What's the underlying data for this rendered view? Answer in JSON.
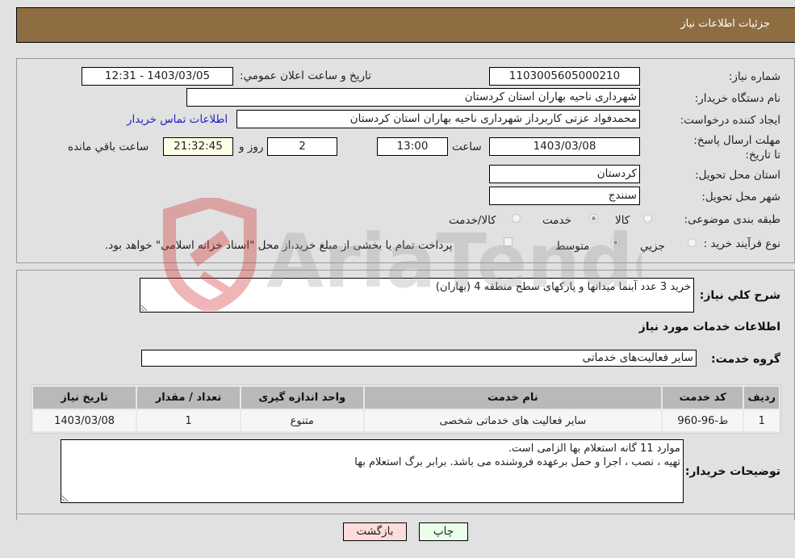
{
  "header": {
    "title": "جزئیات اطلاعات نیاز"
  },
  "form": {
    "need_number": {
      "label": "شماره نیاز:",
      "value": "1103005605000210"
    },
    "announce_datetime": {
      "label": "تاریخ و ساعت اعلان عمومي:",
      "value": "1403/03/05 - 12:31"
    },
    "buyer_org": {
      "label": "نام دستگاه خریدار:",
      "value": "شهرداری ناحیه بهاران استان کردستان"
    },
    "requester": {
      "label": "ایجاد کننده درخواست:",
      "value": "محمدفواد عزتی کاربرداز شهرداری ناحیه بهاران استان کردستان"
    },
    "buyer_contact_link": "اطلاعات تماس خریدار",
    "deadline": {
      "label": "مهلت ارسال پاسخ: تا تاریخ:",
      "date": "1403/03/08",
      "time_label": "ساعت",
      "time": "13:00",
      "days": "2",
      "days_label": "روز و",
      "remaining": "21:32:45",
      "remaining_label": "ساعت باقي مانده"
    },
    "delivery_province": {
      "label": "استان محل تحویل:",
      "value": "کردستان"
    },
    "delivery_city": {
      "label": "شهر محل تحویل:",
      "value": "سنندج"
    },
    "category": {
      "label": "طبقه بندی موضوعی:",
      "options": [
        {
          "label": "کالا",
          "selected": false
        },
        {
          "label": "خدمت",
          "selected": true
        },
        {
          "label": "کالا/خدمت",
          "selected": false
        }
      ]
    },
    "purchase_process": {
      "label": "نوع فرآیند خرید :",
      "options": [
        {
          "label": "جزيي",
          "selected": false
        },
        {
          "label": "متوسط",
          "selected": true
        }
      ],
      "treasury_checkbox": {
        "label": "پرداخت تمام یا بخشی از مبلغ خرید،از محل \"اسناد خزانه اسلامی\" خواهد بود.",
        "checked": false
      }
    }
  },
  "details": {
    "summary_label": "شرح کلي نیاز:",
    "summary_value": "خرید 3 عدد آبنما میدانها و پارکهای سطح منطقه 4 (بهاران)",
    "services_heading": "اطلاعات خدمات مورد نیاز",
    "service_group_label": "گروه خدمت:",
    "service_group_value": "سایر فعالیت‌های خدماتی",
    "table": {
      "columns": [
        "ردیف",
        "کد خدمت",
        "نام خدمت",
        "واحد اندازه گیری",
        "تعداد / مقدار",
        "تاریخ نیاز"
      ],
      "rows": [
        [
          "1",
          "ط-96-960",
          "سایر فعالیت های خدماتی شخصی",
          "متنوع",
          "1",
          "1403/03/08"
        ]
      ]
    },
    "buyer_notes_label": "توضیحات خریدار:",
    "buyer_notes_value": "موارد 11 گانه استعلام بها الزامی است.\nتهیه ، نصب ، اجرا و حمل برعهده فروشنده می باشد. برابر برگ استعلام بها"
  },
  "buttons": {
    "print": "چاپ",
    "back": "بازگشت"
  },
  "colors": {
    "header_bg": "#8e6d42",
    "print_bg": "#eaffea",
    "back_bg": "#ffdcdc",
    "link": "#2222cc",
    "remaining_bg": "#ffffe8"
  },
  "watermark": {
    "text": "AriaTender.neT"
  }
}
